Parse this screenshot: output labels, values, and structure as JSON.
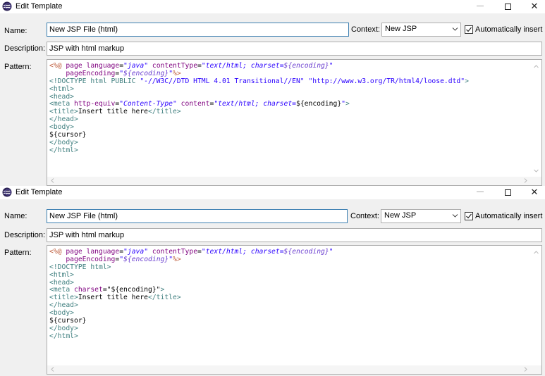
{
  "dialogs": [
    {
      "title": "Edit Template",
      "name_label": "Name:",
      "name_value": "New JSP File (html)",
      "context_label": "Context:",
      "context_value": "New JSP",
      "auto_insert_label": "Automatically insert",
      "auto_insert_checked": true,
      "description_label": "Description:",
      "description_value": "JSP with html markup",
      "pattern_label": "Pattern:",
      "pattern_lines": [
        [
          {
            "c": "tk-jsp",
            "t": "<%@ "
          },
          {
            "c": "tk-attr",
            "t": "page "
          },
          {
            "c": "tk-attr",
            "t": "language"
          },
          {
            "c": "tk-txt",
            "t": "="
          },
          {
            "c": "tk-it",
            "t": "\"java\""
          },
          {
            "c": "tk-txt",
            "t": " "
          },
          {
            "c": "tk-attr",
            "t": "contentType"
          },
          {
            "c": "tk-txt",
            "t": "="
          },
          {
            "c": "tk-it",
            "t": "\"text/html; charset="
          },
          {
            "c": "tk-vit",
            "t": "${encoding}"
          },
          {
            "c": "tk-it",
            "t": "\""
          }
        ],
        [
          {
            "c": "tk-txt",
            "t": "    "
          },
          {
            "c": "tk-attr",
            "t": "pageEncoding"
          },
          {
            "c": "tk-txt",
            "t": "="
          },
          {
            "c": "tk-it",
            "t": "\""
          },
          {
            "c": "tk-vit",
            "t": "${encoding}"
          },
          {
            "c": "tk-it",
            "t": "\""
          },
          {
            "c": "tk-jsp",
            "t": "%>"
          }
        ],
        [
          {
            "c": "tk-dt",
            "t": "<!DOCTYPE html PUBLIC "
          },
          {
            "c": "tk-val",
            "t": "\"-//W3C//DTD HTML 4.01 Transitional//EN\" \"http://www.w3.org/TR/html4/loose.dtd\""
          },
          {
            "c": "tk-dt",
            "t": ">"
          }
        ],
        [
          {
            "c": "tk-tag",
            "t": "<html>"
          }
        ],
        [
          {
            "c": "tk-tag",
            "t": "<head>"
          }
        ],
        [
          {
            "c": "tk-tag",
            "t": "<meta "
          },
          {
            "c": "tk-attr",
            "t": "http-equiv"
          },
          {
            "c": "tk-txt",
            "t": "="
          },
          {
            "c": "tk-it",
            "t": "\"Content-Type\""
          },
          {
            "c": "tk-txt",
            "t": " "
          },
          {
            "c": "tk-attr",
            "t": "content"
          },
          {
            "c": "tk-txt",
            "t": "="
          },
          {
            "c": "tk-it",
            "t": "\"text/html; charset="
          },
          {
            "c": "tk-txt",
            "t": "${encoding}"
          },
          {
            "c": "tk-it",
            "t": "\""
          },
          {
            "c": "tk-tag",
            "t": ">"
          }
        ],
        [
          {
            "c": "tk-tag",
            "t": "<title>"
          },
          {
            "c": "tk-txt",
            "t": "Insert title here"
          },
          {
            "c": "tk-tag",
            "t": "</title>"
          }
        ],
        [
          {
            "c": "tk-tag",
            "t": "</head>"
          }
        ],
        [
          {
            "c": "tk-tag",
            "t": "<body>"
          }
        ],
        [
          {
            "c": "tk-txt",
            "t": "${cursor}"
          }
        ],
        [
          {
            "c": "tk-tag",
            "t": "</body>"
          }
        ],
        [
          {
            "c": "tk-tag",
            "t": "</html>"
          }
        ]
      ]
    },
    {
      "title": "Edit Template",
      "name_label": "Name:",
      "name_value": "New JSP File (html)",
      "context_label": "Context:",
      "context_value": "New JSP",
      "auto_insert_label": "Automatically insert",
      "auto_insert_checked": true,
      "description_label": "Description:",
      "description_value": "JSP with html markup",
      "pattern_label": "Pattern:",
      "pattern_lines": [
        [
          {
            "c": "tk-jsp",
            "t": "<%@ "
          },
          {
            "c": "tk-attr",
            "t": "page "
          },
          {
            "c": "tk-attr",
            "t": "language"
          },
          {
            "c": "tk-txt",
            "t": "="
          },
          {
            "c": "tk-it",
            "t": "\"java\""
          },
          {
            "c": "tk-txt",
            "t": " "
          },
          {
            "c": "tk-attr",
            "t": "contentType"
          },
          {
            "c": "tk-txt",
            "t": "="
          },
          {
            "c": "tk-it",
            "t": "\"text/html; charset="
          },
          {
            "c": "tk-vit",
            "t": "${encoding}"
          },
          {
            "c": "tk-it",
            "t": "\""
          }
        ],
        [
          {
            "c": "tk-txt",
            "t": "    "
          },
          {
            "c": "tk-attr",
            "t": "pageEncoding"
          },
          {
            "c": "tk-txt",
            "t": "="
          },
          {
            "c": "tk-it",
            "t": "\""
          },
          {
            "c": "tk-vit",
            "t": "${encoding}"
          },
          {
            "c": "tk-it",
            "t": "\""
          },
          {
            "c": "tk-jsp",
            "t": "%>"
          }
        ],
        [
          {
            "c": "tk-dt",
            "t": "<!DOCTYPE "
          },
          {
            "c": "tk-tag",
            "t": "html>"
          }
        ],
        [
          {
            "c": "tk-tag",
            "t": "<html>"
          }
        ],
        [
          {
            "c": "tk-tag",
            "t": "<head>"
          }
        ],
        [
          {
            "c": "tk-tag",
            "t": "<meta "
          },
          {
            "c": "tk-attr",
            "t": "charset"
          },
          {
            "c": "tk-txt",
            "t": "=\"${encoding}\""
          },
          {
            "c": "tk-tag",
            "t": ">"
          }
        ],
        [
          {
            "c": "tk-tag",
            "t": "<title>"
          },
          {
            "c": "tk-txt",
            "t": "Insert title here"
          },
          {
            "c": "tk-tag",
            "t": "</title>"
          }
        ],
        [
          {
            "c": "tk-tag",
            "t": "</head>"
          }
        ],
        [
          {
            "c": "tk-tag",
            "t": "<body>"
          }
        ],
        [
          {
            "c": "tk-txt",
            "t": "${cursor}"
          }
        ],
        [
          {
            "c": "tk-tag",
            "t": "</body>"
          }
        ],
        [
          {
            "c": "tk-tag",
            "t": "</html>"
          }
        ]
      ]
    }
  ]
}
